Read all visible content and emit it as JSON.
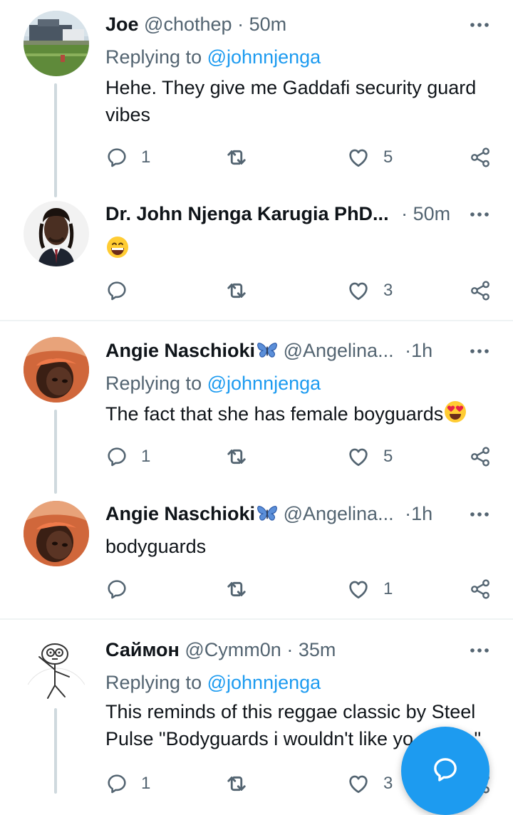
{
  "colors": {
    "accent": "#1d9bf0",
    "text_primary": "#0f1419",
    "text_secondary": "#536471",
    "thread_line": "#cfd9de"
  },
  "tweets": [
    {
      "name": "Joe",
      "handle": "@chothep",
      "time": "50m",
      "replying_prefix": "Replying to",
      "replying_mention": "@johnnjenga",
      "text": "Hehe. They give me Gaddafi security guard vibes",
      "reply_count": "1",
      "like_count": "5",
      "avatar_icon": "photo-building-avatar"
    },
    {
      "name": "Dr. John Njenga Karugia PhD...",
      "time": "50m",
      "text_emoji": "grinning-face-emoji",
      "like_count": "3",
      "avatar_icon": "portrait-avatar"
    },
    {
      "name": "Angie Naschioki",
      "name_icon": "butterfly-emoji",
      "handle": "@Angelina...",
      "time": "1h",
      "replying_prefix": "Replying to",
      "replying_mention": "@johnnjenga",
      "text": "The fact that she has female boyguards",
      "text_emoji": "heart-eyes-emoji",
      "reply_count": "1",
      "like_count": "5",
      "avatar_icon": "selfie-avatar"
    },
    {
      "name": "Angie Naschioki",
      "name_icon": "butterfly-emoji",
      "handle": "@Angelina...",
      "time": "1h",
      "text": "bodyguards",
      "like_count": "1",
      "avatar_icon": "selfie-avatar"
    },
    {
      "name": "Саймон",
      "handle": "@Cymm0n",
      "time": "35m",
      "replying_prefix": "Replying to",
      "replying_mention": "@johnnjenga",
      "text_line1": "This reminds of this reggae classic by Steel",
      "text_line2_start": "Pulse \"Bodyguards i wouldn't like yo",
      "text_line2_end": ".\"",
      "reply_count": "1",
      "like_count": "3",
      "avatar_icon": "doodle-avatar"
    }
  ],
  "dot": "·",
  "compose_button_icon": "compose-reply-icon"
}
